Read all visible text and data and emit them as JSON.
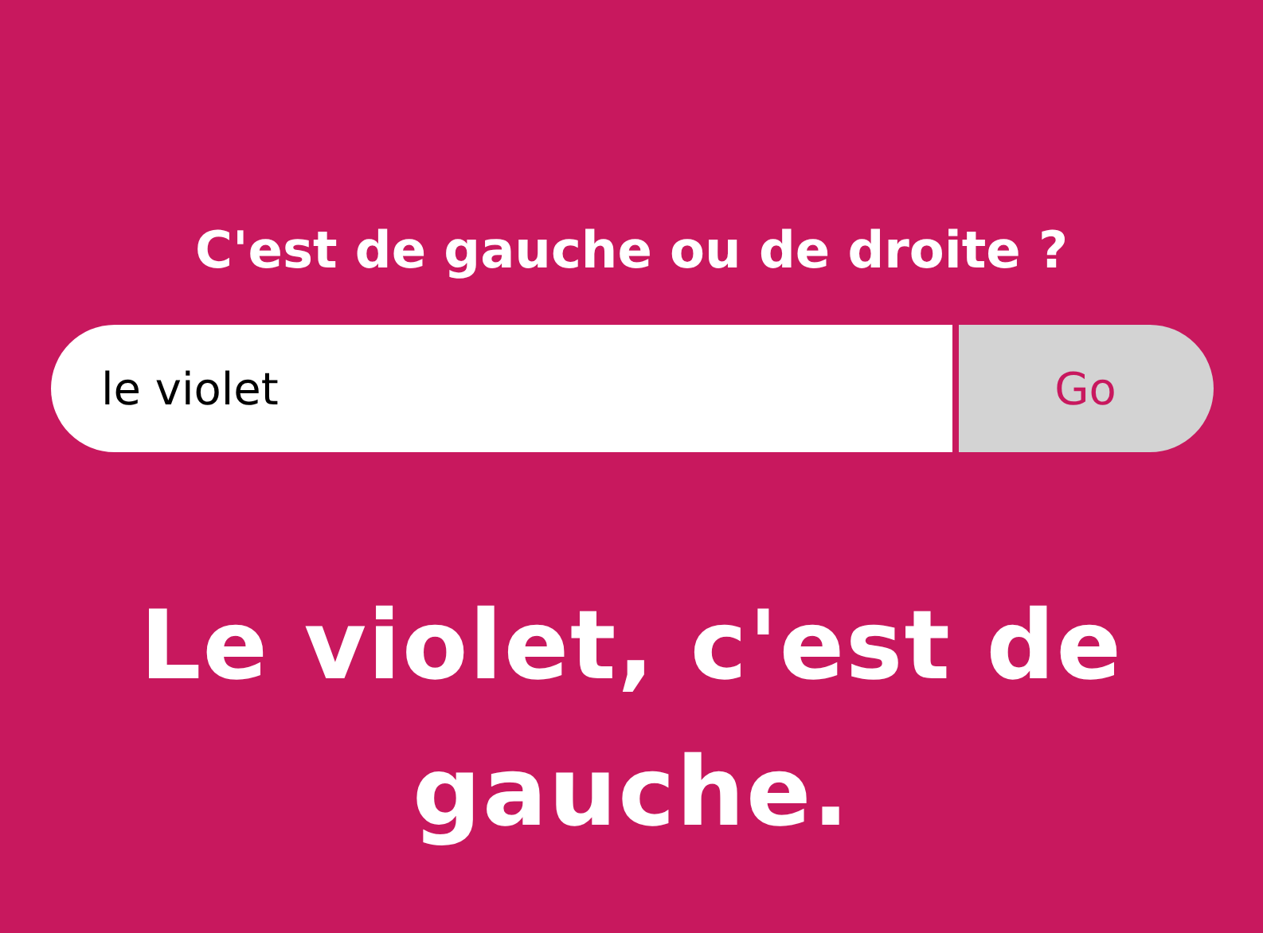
{
  "question": "C'est de gauche ou de droite ?",
  "search": {
    "value": "le violet"
  },
  "button": "Go",
  "answer": "Le violet, c'est de gauche."
}
